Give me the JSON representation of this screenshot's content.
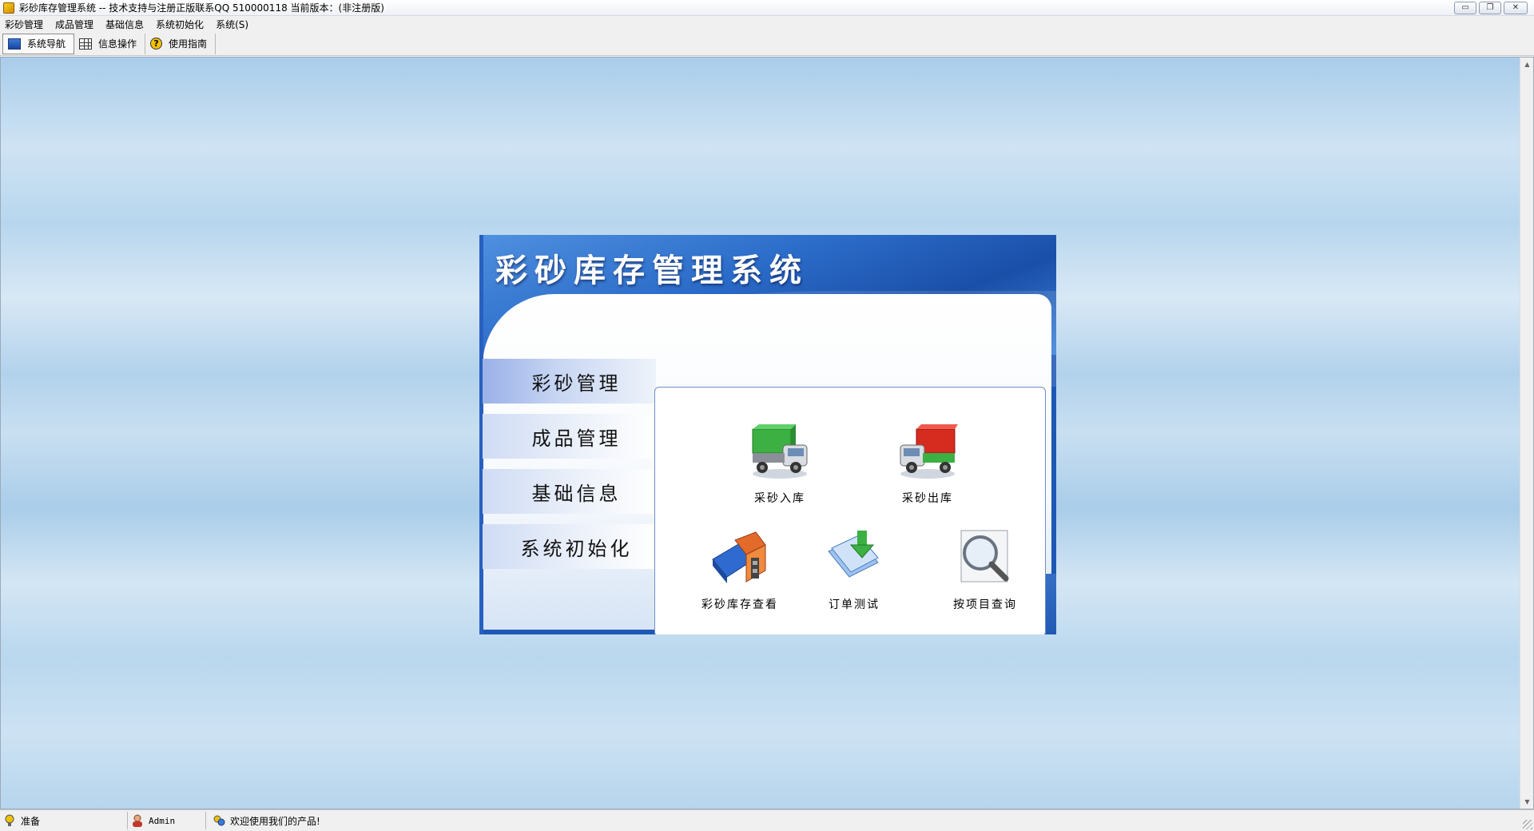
{
  "window": {
    "title": "彩砂库存管理系统 -- 技术支持与注册正版联系QQ 510000118     当前版本：(非注册版)",
    "controls": {
      "minimize": "▭",
      "restore": "❐",
      "close": "✕"
    }
  },
  "menubar": {
    "items": [
      "彩砂管理",
      "成品管理",
      "基础信息",
      "系统初始化",
      "系统(S)"
    ]
  },
  "toolbar": {
    "items": [
      {
        "label": "系统导航",
        "icon": "monitor-icon"
      },
      {
        "label": "信息操作",
        "icon": "grid-icon"
      },
      {
        "label": "使用指南",
        "icon": "help-icon",
        "glyph": "?"
      }
    ]
  },
  "panel": {
    "title": "彩砂库存管理系统",
    "nav": [
      "彩砂管理",
      "成品管理",
      "基础信息",
      "系统初始化"
    ],
    "active_nav": "彩砂管理",
    "tiles": [
      {
        "label": "采砂入库",
        "icon": "green-truck-icon"
      },
      {
        "label": "采砂出库",
        "icon": "red-truck-icon"
      },
      {
        "label": "彩砂库存查看",
        "icon": "inventory-book-icon"
      },
      {
        "label": "订单测试",
        "icon": "order-download-icon"
      },
      {
        "label": "按项目查询",
        "icon": "magnifier-icon"
      }
    ]
  },
  "statusbar": {
    "ready": "准备",
    "user": "Admin",
    "welcome": "欢迎使用我们的产品!"
  },
  "colors": {
    "panel_blue": "#1d58b5",
    "truck_green": "#3cb043",
    "truck_red": "#d62b1f"
  }
}
